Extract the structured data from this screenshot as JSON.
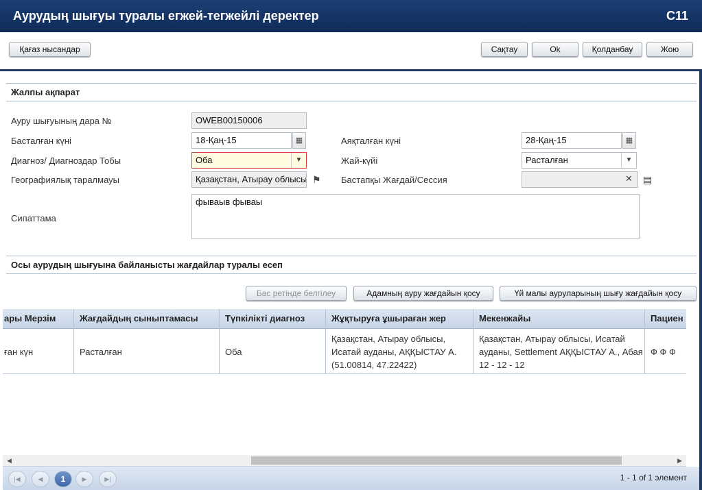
{
  "window": {
    "title": "Аурудың шығуы туралы егжей-тегжейлі деректер",
    "code": "C11"
  },
  "toolbar": {
    "paper_forms": "Қағаз нысандар",
    "save": "Сақтау",
    "ok": "Ok",
    "apply": "Қолданбау",
    "delete": "Жою"
  },
  "general": {
    "section_title": "Жалпы ақпарат",
    "case_number_label": "Ауру шығуының дара №",
    "case_number_value": "OWEB00150006",
    "start_date_label": "Басталған күні",
    "start_date_value": "18-Қаң-15",
    "end_date_label": "Аяқталған күні",
    "end_date_value": "28-Қаң-15",
    "diagnosis_label": "Диагноз/ Диагноздар Тобы",
    "diagnosis_value": "Оба",
    "status_label": "Жай-күйі",
    "status_value": "Расталған",
    "geo_label": "Географиялық таралмауы",
    "geo_value": "Қазақстан, Атырау облысы",
    "primary_session_label": "Бастапқы Жағдай/Сессия",
    "primary_session_value": "",
    "description_label": "Сипаттама",
    "description_value": "фываыв фываы"
  },
  "report": {
    "section_title": "Осы аурудың шығуына байланысты жағдайлар туралы есеп",
    "mark_primary": "Бас ретінде белгілеу",
    "add_human_case": "Адамның ауру жағдайын қосу",
    "add_livestock_case": "Үй малы ауруларының шығу жағдайын қосу",
    "columns": [
      "ары Мерзім",
      "Жағдайдың сыныптамасы",
      "Түпкілікті диагноз",
      "Жұқтыруға ұшыраған жер",
      "Мекенжайы",
      "Пациен"
    ],
    "rows": [
      [
        "ған күн",
        "Расталған",
        "Оба",
        "Қазақстан, Атырау облысы, Исатай ауданы, АҚҚЫСТАУ А. (51.00814, 47.22422)",
        "Қазақстан, Атырау облысы, Исатай ауданы, Settlement АҚҚЫСТАУ А., Абая 12 - 12 - 12",
        "Ф Ф Ф"
      ]
    ]
  },
  "pager": {
    "current_page": "1",
    "summary": "1 - 1 of 1 элемент"
  },
  "icons": {
    "calendar": "calendar-icon",
    "dropdown": "chevron-down-icon",
    "clear": "close-icon",
    "location": "map-pin-icon",
    "document": "document-icon"
  }
}
